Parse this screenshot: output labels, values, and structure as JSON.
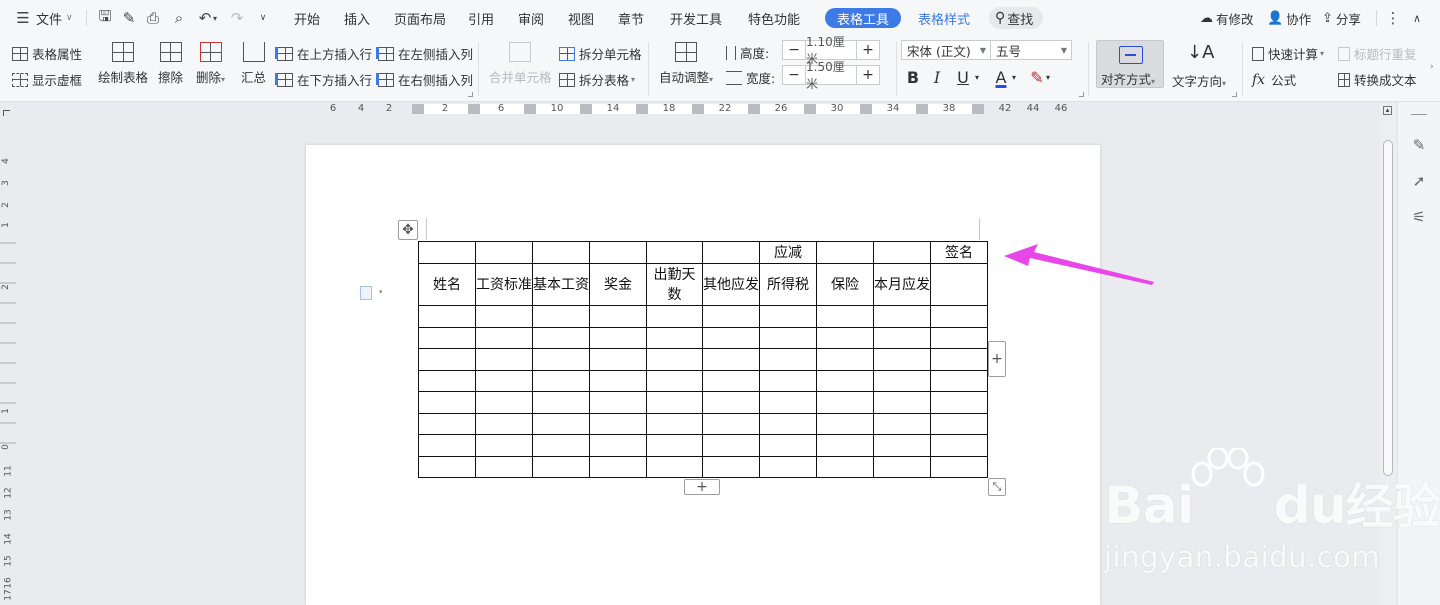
{
  "menubar": {
    "file_label": "文件",
    "tabs": [
      "开始",
      "插入",
      "页面布局",
      "引用",
      "审阅",
      "视图",
      "章节",
      "开发工具",
      "特色功能"
    ],
    "active_tab": "表格工具",
    "secondary_tab": "表格样式",
    "search_label": "查找",
    "has_changes": "有修改",
    "collaborate": "协作",
    "share": "分享"
  },
  "ribbon": {
    "table_props": "表格属性",
    "show_grid": "显示虚框",
    "draw_table": "绘制表格",
    "erase": "擦除",
    "delete": "删除",
    "summary": "汇总",
    "insert_above": "在上方插入行",
    "insert_below": "在下方插入行",
    "insert_left": "在左侧插入列",
    "insert_right": "在右侧插入列",
    "merge_cells": "合并单元格",
    "split_cells": "拆分单元格",
    "split_table": "拆分表格",
    "auto_fit": "自动调整",
    "height_label": "高度:",
    "height_value": "1.10厘米",
    "width_label": "宽度:",
    "width_value": "1.50厘米",
    "font_name": "宋体 (正文)",
    "font_size": "五号",
    "align": "对齐方式",
    "text_direction": "文字方向",
    "quick_calc": "快速计算",
    "repeat_header": "标题行重复",
    "formula": "公式",
    "to_text": "转换成文本"
  },
  "ruler": {
    "h_numbers": [
      "6",
      "4",
      "2",
      "2",
      "6",
      "10",
      "14",
      "18",
      "22",
      "26",
      "30",
      "34",
      "38",
      "42",
      "44",
      "46"
    ],
    "v_numbers": [
      "4",
      "3",
      "2",
      "1",
      "2",
      "1",
      "0",
      "11",
      "12",
      "13",
      "14",
      "15",
      "16",
      "17"
    ]
  },
  "table": {
    "row0": [
      "",
      "",
      "",
      "",
      "",
      "",
      "应减",
      "",
      "",
      "签名"
    ],
    "row1": [
      "姓名",
      "工资标准",
      "基本工资",
      "奖金",
      "出勤天数",
      "其他应发",
      "所得税",
      "保险",
      "本月应发",
      ""
    ],
    "data_rows": 8,
    "cols": 10
  },
  "watermark": {
    "brand_latin": "Bai",
    "brand_du": "du",
    "brand_cn": "经验",
    "url": "jingyan.baidu.com"
  },
  "colors": {
    "accent": "#3d7ae5",
    "arrow": "#e846e8"
  }
}
